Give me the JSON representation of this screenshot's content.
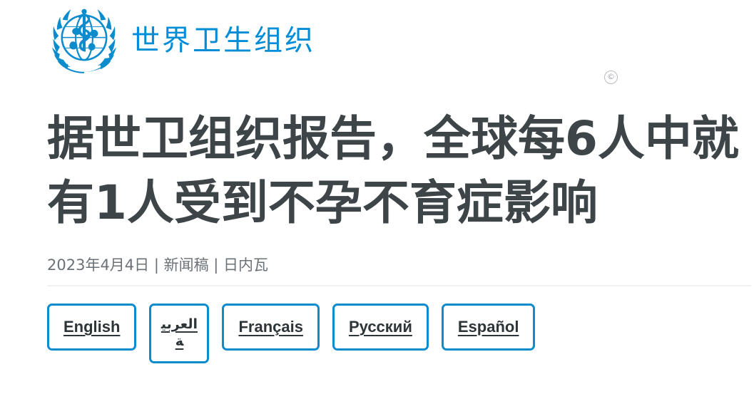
{
  "header": {
    "logo_icon": "who-emblem-icon",
    "logo_alt": "世界卫生组织",
    "wordmark": "世界卫生组织",
    "brand_color": "#008cd6"
  },
  "copyright": {
    "symbol": "©",
    "icon": "copyright-icon",
    "color": "#9ea2a7"
  },
  "article": {
    "headline": "据世卫组织报告，全球每6人中就有1人受到不孕不育症影响",
    "meta": "2023年4月4日 | 新闻稿 | 日内瓦",
    "date": "2023年4月4日",
    "type": "新闻稿",
    "location": "日内瓦",
    "headline_color": "#3d4549",
    "meta_color": "#6b7177"
  },
  "languages": {
    "border_color": "#0d8ccd",
    "link_color": "#2e3538",
    "items": [
      {
        "label": "English",
        "name": "lang-english"
      },
      {
        "label": "العربية",
        "name": "lang-arabic"
      },
      {
        "label": "Français",
        "name": "lang-french"
      },
      {
        "label": "Русский",
        "name": "lang-russian"
      },
      {
        "label": "Español",
        "name": "lang-spanish"
      }
    ]
  }
}
